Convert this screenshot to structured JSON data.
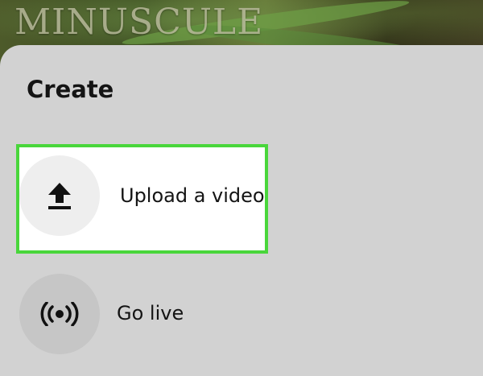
{
  "background": {
    "channel_logo_text": "MINUSCULE"
  },
  "sheet": {
    "title": "Create",
    "options": [
      {
        "label": "Upload a video",
        "icon": "upload-icon",
        "highlighted": true
      },
      {
        "label": "Go live",
        "icon": "live-broadcast-icon",
        "highlighted": false
      }
    ]
  },
  "colors": {
    "sheet_background": "#d2d2d2",
    "highlight_border": "#49d63b",
    "highlight_fill": "#ffffff",
    "text": "#141414"
  }
}
